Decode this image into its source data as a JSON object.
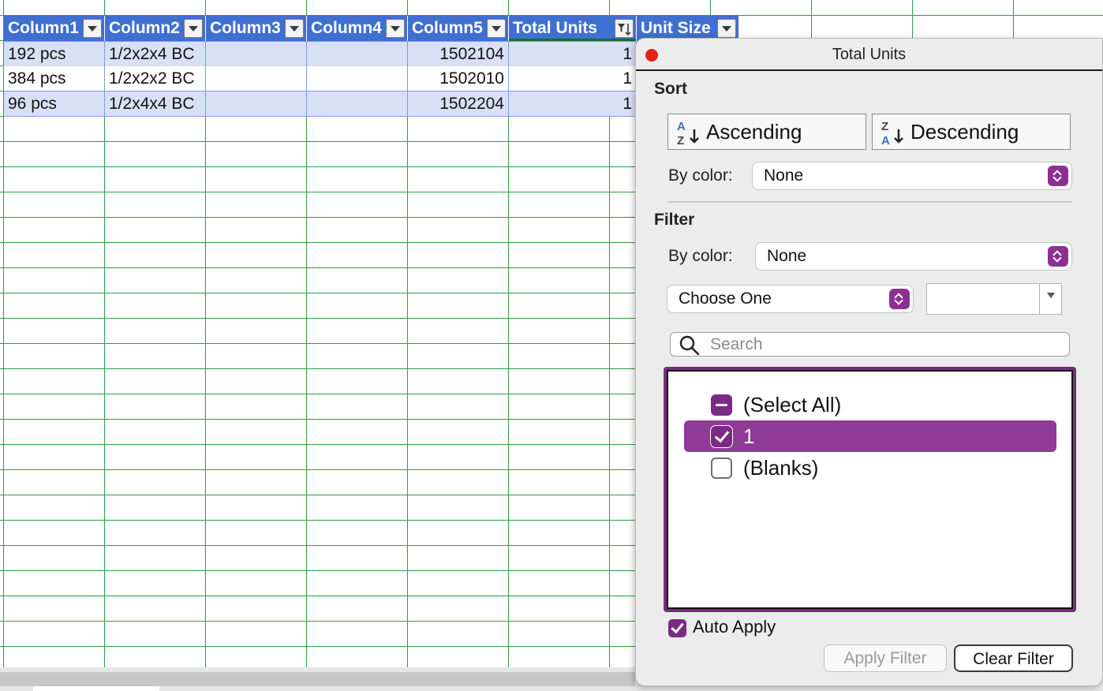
{
  "table": {
    "headers": [
      {
        "label": "Column1"
      },
      {
        "label": "Column2"
      },
      {
        "label": "Column3"
      },
      {
        "label": "Column4"
      },
      {
        "label": "Column5"
      },
      {
        "label": "Total Units"
      },
      {
        "label": "Unit Size"
      }
    ],
    "rows": [
      {
        "c1": "192 pcs",
        "c2": "1/2x2x4 BC",
        "c3": "",
        "c4": "",
        "c5": "1502104",
        "c6": "1"
      },
      {
        "c1": "384 pcs",
        "c2": "1/2x2x2 BC",
        "c3": "",
        "c4": "",
        "c5": "1502010",
        "c6": "1"
      },
      {
        "c1": "96 pcs",
        "c2": "1/2x4x4 BC",
        "c3": "",
        "c4": "",
        "c5": "1502204",
        "c6": "1"
      }
    ]
  },
  "filter_panel": {
    "title": "Total Units",
    "sort": {
      "section_label": "Sort",
      "ascending_label": "Ascending",
      "descending_label": "Descending",
      "by_color_label": "By color:",
      "by_color_value": "None"
    },
    "filter": {
      "section_label": "Filter",
      "by_color_label": "By color:",
      "by_color_value": "None",
      "condition_value": "Choose One",
      "condition_input_value": "",
      "search_placeholder": "Search",
      "items": [
        {
          "label": "(Select All)",
          "state": "mixed"
        },
        {
          "label": "1",
          "state": "checked",
          "selected": true
        },
        {
          "label": "(Blanks)",
          "state": "unchecked"
        }
      ]
    },
    "auto_apply_label": "Auto Apply",
    "auto_apply_checked": true,
    "apply_button_label": "Apply Filter",
    "clear_button_label": "Clear Filter"
  },
  "colors": {
    "header_blue": "#3f6fd0",
    "band_blue": "#d8e0f5",
    "accent_purple": "#7b2b84",
    "grid_green": "#2e9b46",
    "close_red": "#e0231b"
  }
}
